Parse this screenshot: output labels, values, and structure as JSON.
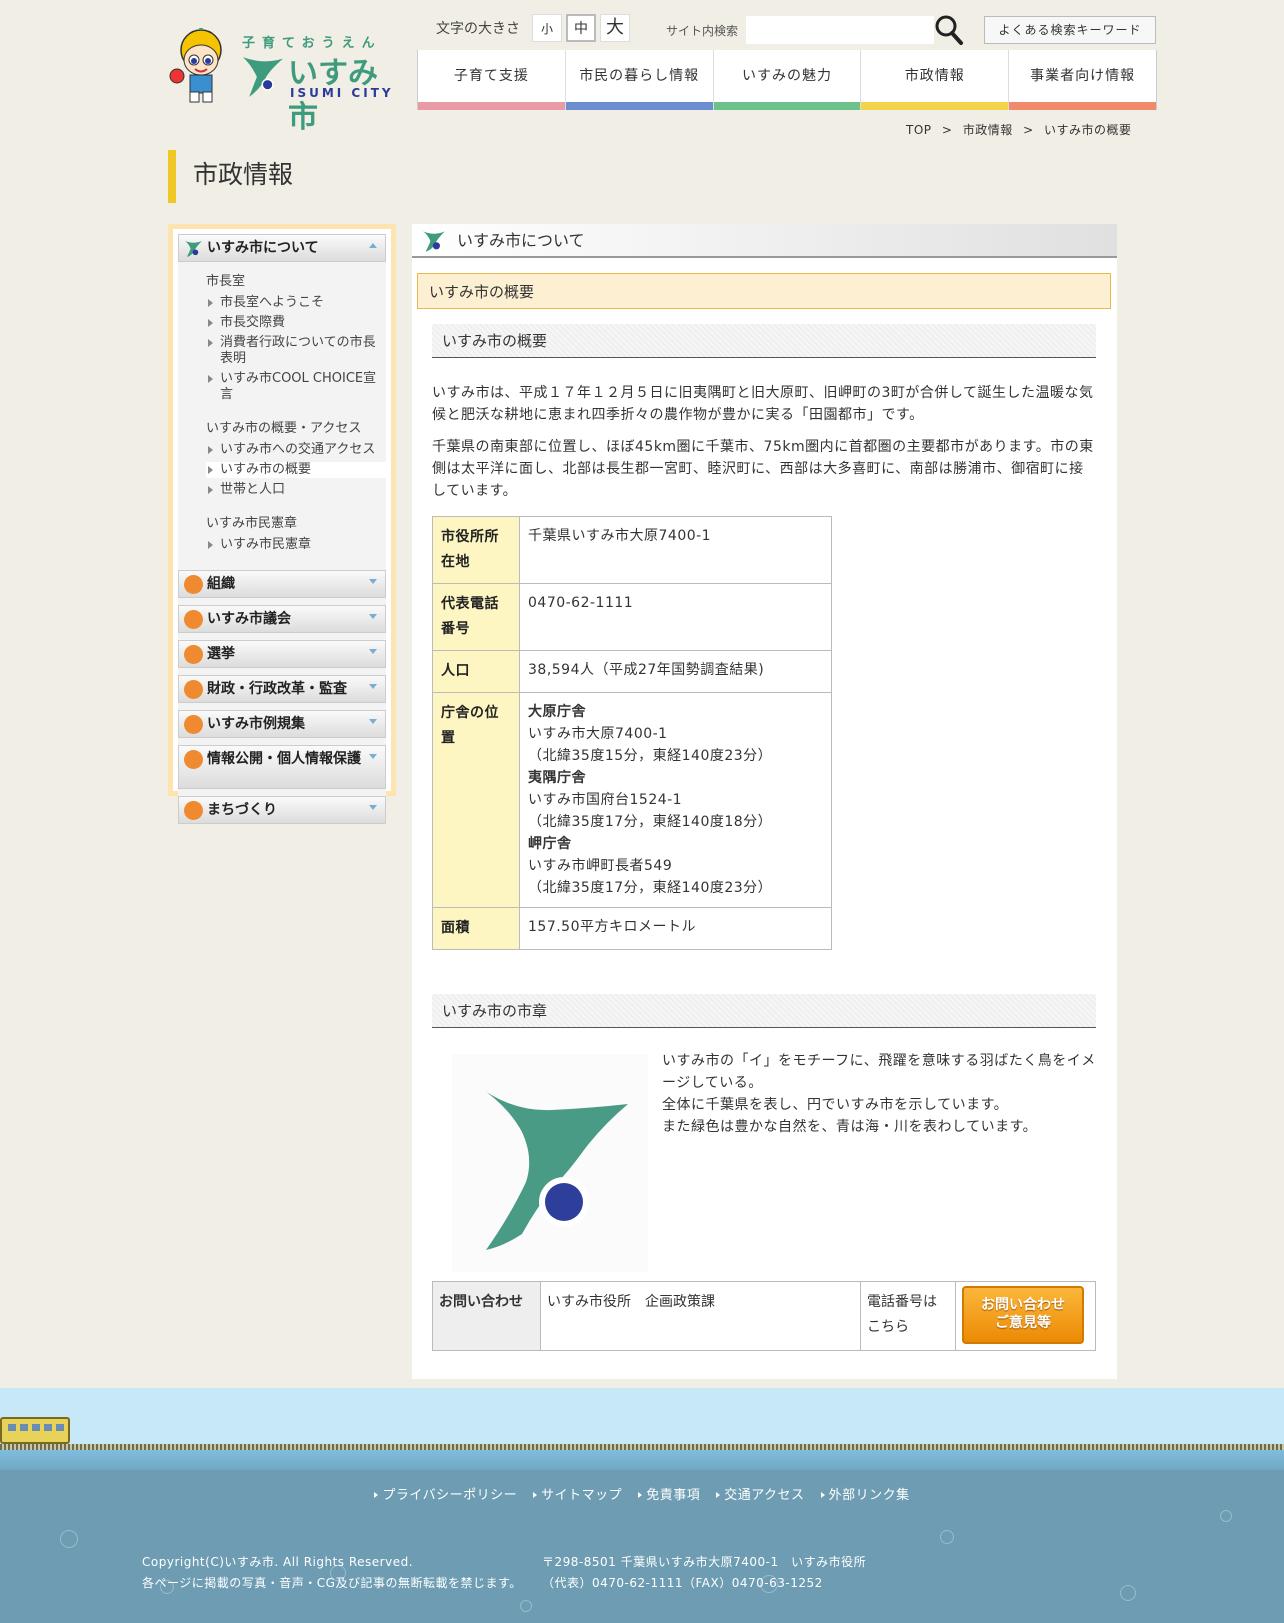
{
  "header": {
    "logo_tagline": "子育ておうえん",
    "logo_name": "いすみ市",
    "logo_en": "ISUMI CITY",
    "font_size_label": "文字の大きさ",
    "font_sizes": [
      "小",
      "中",
      "大"
    ],
    "search_label": "サイト内検索",
    "search_value": "",
    "keyword_button": "よくある検索キーワード"
  },
  "gnav": [
    {
      "label": "子育て支援",
      "color": "#e89aa6"
    },
    {
      "label": "市民の暮らし情報",
      "color": "#6c8ed0"
    },
    {
      "label": "いすみの魅力",
      "color": "#6cc28a"
    },
    {
      "label": "市政情報",
      "color": "#f3d34a"
    },
    {
      "label": "事業者向け情報",
      "color": "#f08a6a"
    }
  ],
  "breadcrumb": [
    "TOP",
    ">",
    "市政情報",
    ">",
    "いすみ市の概要"
  ],
  "page_title": "市政情報",
  "sidebar": {
    "head": "いすみ市について",
    "groups": [
      {
        "title": "市長室",
        "links": [
          "市長室へようこそ",
          "市長交際費",
          "消費者行政についての市長表明",
          "いすみ市COOL CHOICE宣言"
        ]
      },
      {
        "title": "いすみ市の概要・アクセス",
        "links": [
          "いすみ市への交通アクセス",
          "いすみ市の概要",
          "世帯と人口"
        ]
      },
      {
        "title": "いすみ市民憲章",
        "links": [
          "いすみ市民憲章"
        ]
      }
    ],
    "menus": [
      "組織",
      "いすみ市議会",
      "選挙",
      "財政・行政改革・監査",
      "いすみ市例規集",
      "情報公開・個人情報保護",
      "まちづくり"
    ]
  },
  "main": {
    "section_head": "いすみ市について",
    "page_heading": "いすみ市の概要",
    "h3_overview": "いすみ市の概要",
    "para1": "いすみ市は、平成１７年１２月５日に旧夷隅町と旧大原町、旧岬町の3町が合併して誕生した温暖な気候と肥沃な耕地に恵まれ四季折々の農作物が豊かに実る「田園都市」です。",
    "para2": "千葉県の南東部に位置し、ほぼ45km圏に千葉市、75km圏内に首都圏の主要都市があります。市の東側は太平洋に面し、北部は長生郡一宮町、睦沢町に、西部は大多喜町に、南部は勝浦市、御宿町に接しています。",
    "table": {
      "addr_label": "市役所所在地",
      "addr_value": "千葉県いすみ市大原7400-1",
      "tel_label": "代表電話番号",
      "tel_value": "0470-62-1111",
      "pop_label": "人口",
      "pop_value": "38,594人（平成27年国勢調査結果)",
      "office_label": "庁舎の位置",
      "office1_name": "大原庁舎",
      "office1_addr": "いすみ市大原7400-1",
      "office1_coord": "（北緯35度15分，東経140度23分）",
      "office2_name": "夷隅庁舎",
      "office2_addr": "いすみ市国府台1524-1",
      "office2_coord": "（北緯35度17分，東経140度18分）",
      "office3_name": "岬庁舎",
      "office3_addr": "いすみ市岬町長者549",
      "office3_coord": "（北緯35度17分，東経140度23分）",
      "area_label": "面積",
      "area_value": "157.50平方キロメートル"
    },
    "h3_emblem": "いすみ市の市章",
    "emblem_text1": "いすみ市の「イ」をモチーフに、飛躍を意味する羽ばたく鳥をイメージしている。",
    "emblem_text2": "全体に千葉県を表し、円でいすみ市を示しています。",
    "emblem_text3": "また緑色は豊かな自然を、青は海・川を表わしています。",
    "contact": {
      "label": "お問い合わせ",
      "dept": "いすみ市役所　企画政策課",
      "tel_link": "電話番号はこちら",
      "button_line1": "お問い合わせ",
      "button_line2": "ご意見等"
    }
  },
  "footer": {
    "links": [
      "プライバシーポリシー",
      "サイトマップ",
      "免責事項",
      "交通アクセス",
      "外部リンク集"
    ],
    "copyright": "Copyright(C)いすみ市. All Rights Reserved.",
    "notice": "各ページに掲載の写真・音声・CG及び記事の無断転載を禁じます。",
    "address": "〒298-8501 千葉県いすみ市大原7400-1　いすみ市役所",
    "phone": "（代表）0470-62-1111（FAX）0470-63-1252"
  },
  "colors": {
    "accent_green": "#3f9b7e",
    "emblem_blue": "#2b3b9a",
    "title_bar": "#f0c826"
  }
}
